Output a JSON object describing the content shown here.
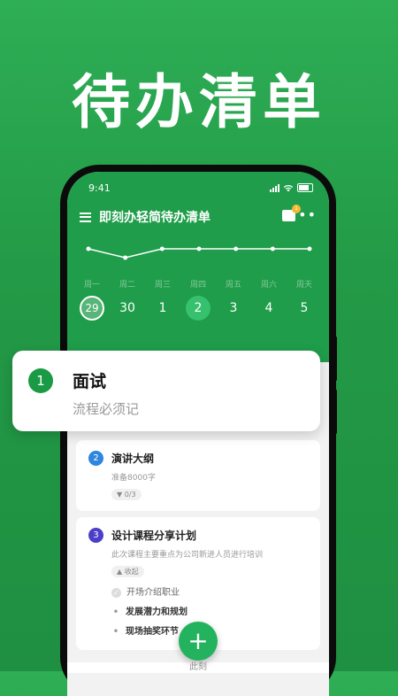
{
  "hero": {
    "title": "待办清单"
  },
  "status": {
    "time": "9:41"
  },
  "app": {
    "title": "即刻办轻简待办清单",
    "notification_count": "1"
  },
  "week": {
    "days": [
      {
        "weekday": "周一",
        "date": "29"
      },
      {
        "weekday": "周二",
        "date": "30"
      },
      {
        "weekday": "周三",
        "date": "1"
      },
      {
        "weekday": "周四",
        "date": "2"
      },
      {
        "weekday": "周五",
        "date": "3"
      },
      {
        "weekday": "周六",
        "date": "4"
      },
      {
        "weekday": "周天",
        "date": "5"
      }
    ],
    "today_index": 0,
    "selected_index": 3,
    "trend_values": [
      3,
      2,
      3,
      3,
      3,
      3,
      3
    ]
  },
  "tasks": [
    {
      "index": "1",
      "title": "面试",
      "note": "流程必须记"
    },
    {
      "index": "2",
      "title": "演讲大纲",
      "note": "准备8000字",
      "progress": "0/3"
    },
    {
      "index": "3",
      "title": "设计课程分享计划",
      "note": "此次课程主要重点为公司新进人员进行培训",
      "collapse_label": "收起",
      "subtasks": [
        {
          "label": "开场介绍职业",
          "done": true
        },
        {
          "label": "发展潜力和规划",
          "done": false
        },
        {
          "label": "现场抽奖环节",
          "done": false
        }
      ]
    }
  ],
  "tabbar": {
    "center_label": "此刻"
  },
  "colors": {
    "brand": "#1f9d4a",
    "accent": "#23b25d",
    "blue": "#2e86de",
    "purple": "#4b3ec9"
  }
}
